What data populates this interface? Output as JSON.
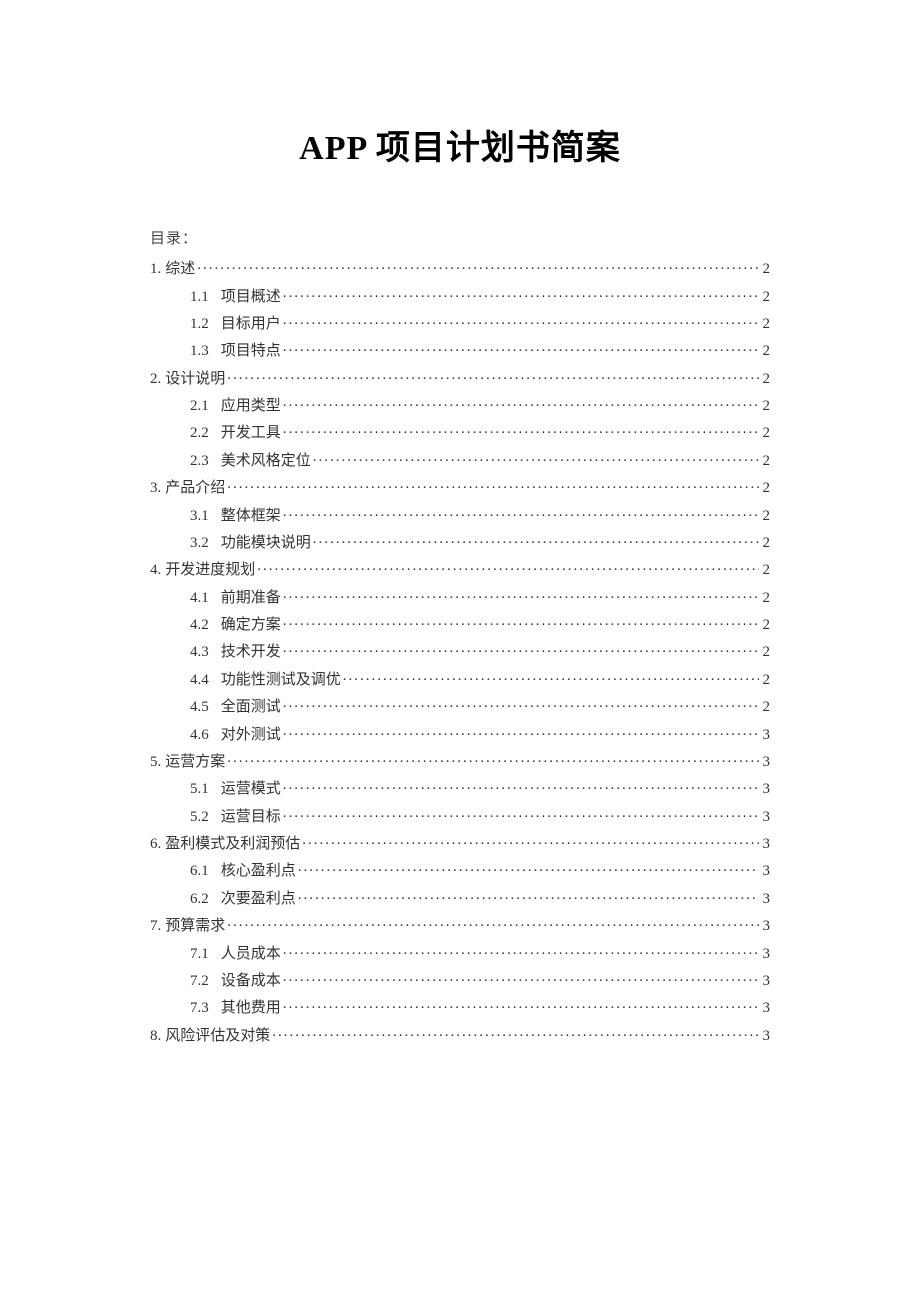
{
  "title": "APP 项目计划书简案",
  "toc_label": "目录：",
  "toc": [
    {
      "level": 1,
      "num": "1.",
      "text": "综述",
      "page": "2"
    },
    {
      "level": 2,
      "num": "1.1",
      "text": "项目概述",
      "page": "2"
    },
    {
      "level": 2,
      "num": "1.2",
      "text": "目标用户",
      "page": "2"
    },
    {
      "level": 2,
      "num": "1.3",
      "text": "项目特点",
      "page": "2"
    },
    {
      "level": 1,
      "num": "2.",
      "text": "设计说明",
      "page": "2"
    },
    {
      "level": 2,
      "num": "2.1",
      "text": "应用类型",
      "page": "2"
    },
    {
      "level": 2,
      "num": "2.2",
      "text": "开发工具",
      "page": "2"
    },
    {
      "level": 2,
      "num": "2.3",
      "text": "美术风格定位",
      "page": "2"
    },
    {
      "level": 1,
      "num": "3.",
      "text": "产品介绍",
      "page": "2"
    },
    {
      "level": 2,
      "num": "3.1",
      "text": "整体框架",
      "page": "2"
    },
    {
      "level": 2,
      "num": "3.2",
      "text": "功能模块说明",
      "page": "2"
    },
    {
      "level": 1,
      "num": "4.",
      "text": "开发进度规划",
      "page": "2"
    },
    {
      "level": 2,
      "num": "4.1",
      "text": "前期准备",
      "page": "2"
    },
    {
      "level": 2,
      "num": "4.2",
      "text": "确定方案",
      "page": "2"
    },
    {
      "level": 2,
      "num": "4.3",
      "text": "技术开发",
      "page": "2"
    },
    {
      "level": 2,
      "num": "4.4",
      "text": "功能性测试及调优",
      "page": "2"
    },
    {
      "level": 2,
      "num": "4.5",
      "text": "全面测试",
      "page": "2"
    },
    {
      "level": 2,
      "num": "4.6",
      "text": "对外测试",
      "page": "3"
    },
    {
      "level": 1,
      "num": "5.",
      "text": "运营方案",
      "page": "3"
    },
    {
      "level": 2,
      "num": "5.1",
      "text": "运营模式",
      "page": "3"
    },
    {
      "level": 2,
      "num": "5.2",
      "text": "运营目标",
      "page": "3"
    },
    {
      "level": 1,
      "num": "6.",
      "text": "盈利模式及利润预估",
      "page": "3"
    },
    {
      "level": 2,
      "num": "6.1",
      "text": "核心盈利点",
      "page": "3"
    },
    {
      "level": 2,
      "num": "6.2",
      "text": "次要盈利点",
      "page": "3"
    },
    {
      "level": 1,
      "num": "7.",
      "text": "预算需求",
      "page": "3"
    },
    {
      "level": 2,
      "num": "7.1",
      "text": "人员成本",
      "page": "3"
    },
    {
      "level": 2,
      "num": "7.2",
      "text": "设备成本",
      "page": "3"
    },
    {
      "level": 2,
      "num": "7.3",
      "text": "其他费用",
      "page": "3"
    },
    {
      "level": 1,
      "num": "8.",
      "text": "风险评估及对策",
      "page": "3"
    }
  ]
}
